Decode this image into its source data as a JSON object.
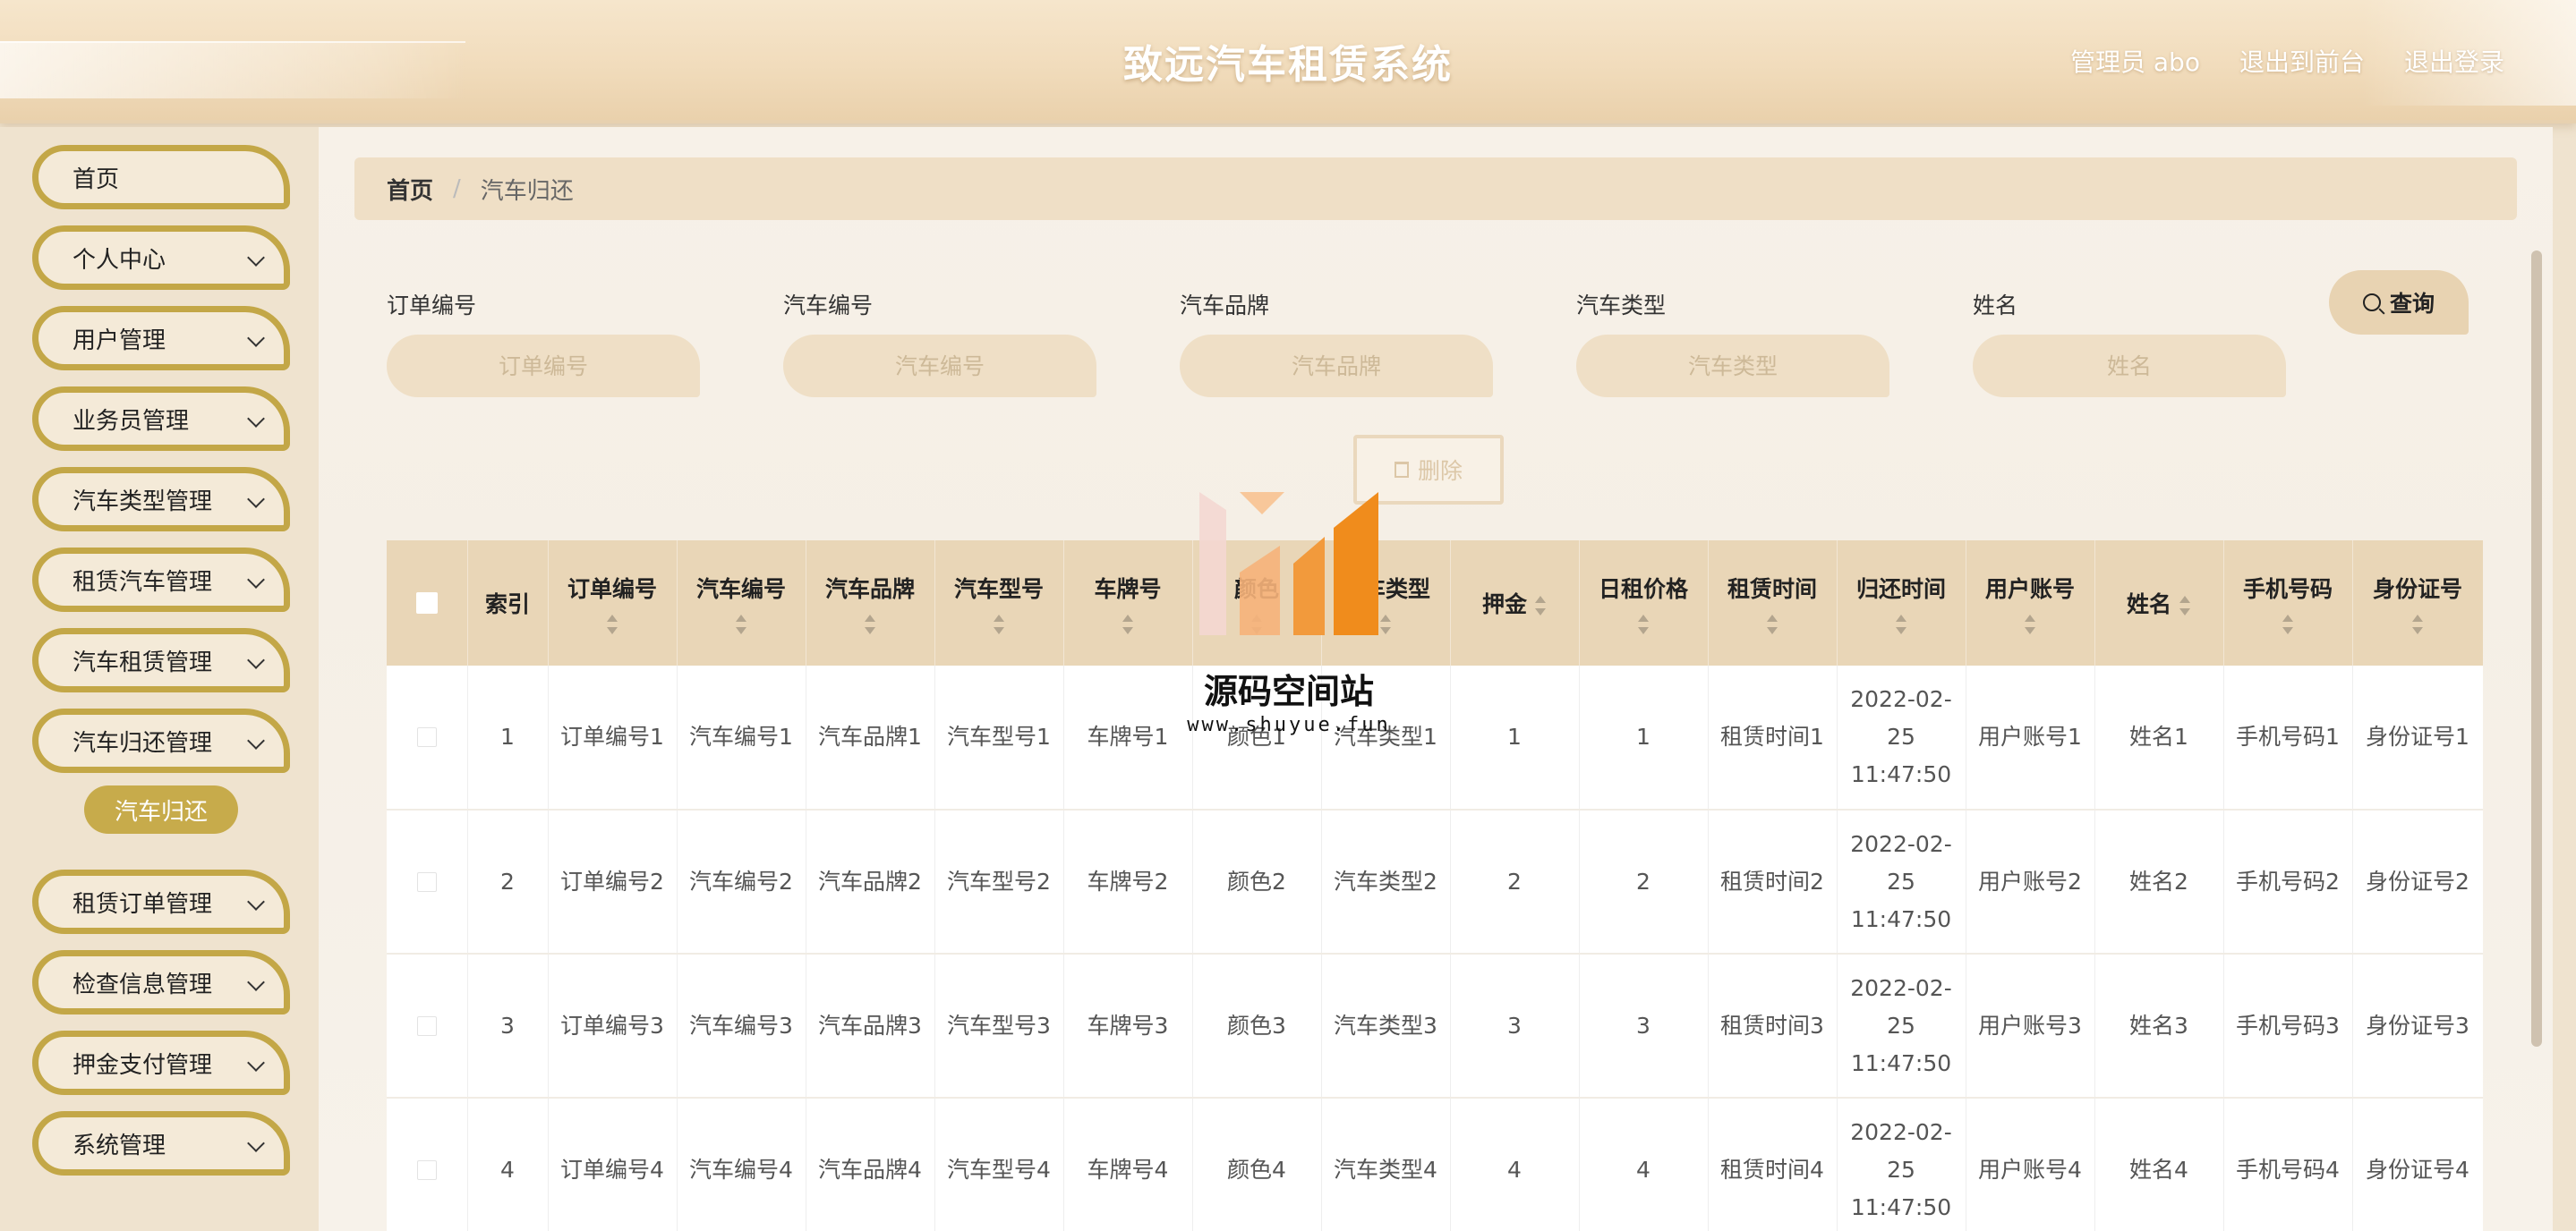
{
  "header": {
    "title": "致远汽车租赁系统",
    "user_label": "管理员 abo",
    "back_to_front": "退出到前台",
    "logout": "退出登录"
  },
  "sidebar": {
    "items": [
      {
        "label": "首页",
        "has_arrow": false
      },
      {
        "label": "个人中心",
        "has_arrow": true
      },
      {
        "label": "用户管理",
        "has_arrow": true
      },
      {
        "label": "业务员管理",
        "has_arrow": true
      },
      {
        "label": "汽车类型管理",
        "has_arrow": true
      },
      {
        "label": "租赁汽车管理",
        "has_arrow": true
      },
      {
        "label": "汽车租赁管理",
        "has_arrow": true
      },
      {
        "label": "汽车归还管理",
        "has_arrow": true
      },
      {
        "label": "租赁订单管理",
        "has_arrow": true
      },
      {
        "label": "检查信息管理",
        "has_arrow": true
      },
      {
        "label": "押金支付管理",
        "has_arrow": true
      },
      {
        "label": "系统管理",
        "has_arrow": true
      }
    ],
    "active_sub": "汽车归还"
  },
  "breadcrumb": {
    "home": "首页",
    "separator": "/",
    "current": "汽车归还"
  },
  "search": {
    "fields": [
      {
        "label": "订单编号",
        "placeholder": "订单编号"
      },
      {
        "label": "汽车编号",
        "placeholder": "汽车编号"
      },
      {
        "label": "汽车品牌",
        "placeholder": "汽车品牌"
      },
      {
        "label": "汽车类型",
        "placeholder": "汽车类型"
      },
      {
        "label": "姓名",
        "placeholder": "姓名"
      }
    ],
    "query_label": "查询"
  },
  "actions": {
    "delete_label": "删除"
  },
  "table": {
    "columns": [
      "索引",
      "订单编号",
      "汽车编号",
      "汽车品牌",
      "汽车型号",
      "车牌号",
      "颜色",
      "汽车类型",
      "押金",
      "日租价格",
      "租赁时间",
      "归还时间",
      "用户账号",
      "姓名",
      "手机号码",
      "身份证号"
    ],
    "rows": [
      [
        "1",
        "订单编号1",
        "汽车编号1",
        "汽车品牌1",
        "汽车型号1",
        "车牌号1",
        "颜色1",
        "汽车类型1",
        "1",
        "1",
        "租赁时间1",
        "2022-02-25 11:47:50",
        "用户账号1",
        "姓名1",
        "手机号码1",
        "身份证号1"
      ],
      [
        "2",
        "订单编号2",
        "汽车编号2",
        "汽车品牌2",
        "汽车型号2",
        "车牌号2",
        "颜色2",
        "汽车类型2",
        "2",
        "2",
        "租赁时间2",
        "2022-02-25 11:47:50",
        "用户账号2",
        "姓名2",
        "手机号码2",
        "身份证号2"
      ],
      [
        "3",
        "订单编号3",
        "汽车编号3",
        "汽车品牌3",
        "汽车型号3",
        "车牌号3",
        "颜色3",
        "汽车类型3",
        "3",
        "3",
        "租赁时间3",
        "2022-02-25 11:47:50",
        "用户账号3",
        "姓名3",
        "手机号码3",
        "身份证号3"
      ],
      [
        "4",
        "订单编号4",
        "汽车编号4",
        "汽车品牌4",
        "汽车型号4",
        "车牌号4",
        "颜色4",
        "汽车类型4",
        "4",
        "4",
        "租赁时间4",
        "2022-02-25 11:47:50",
        "用户账号4",
        "姓名4",
        "手机号码4",
        "身份证号4"
      ]
    ]
  },
  "watermark": {
    "text": "源码空间站",
    "url": "www.shuyue.fun"
  },
  "colors": {
    "accent_gold": "#c3a747",
    "header_bg": "#f1dcbc",
    "table_header_bg": "#e9d6b7",
    "input_bg": "#efdfc6"
  }
}
